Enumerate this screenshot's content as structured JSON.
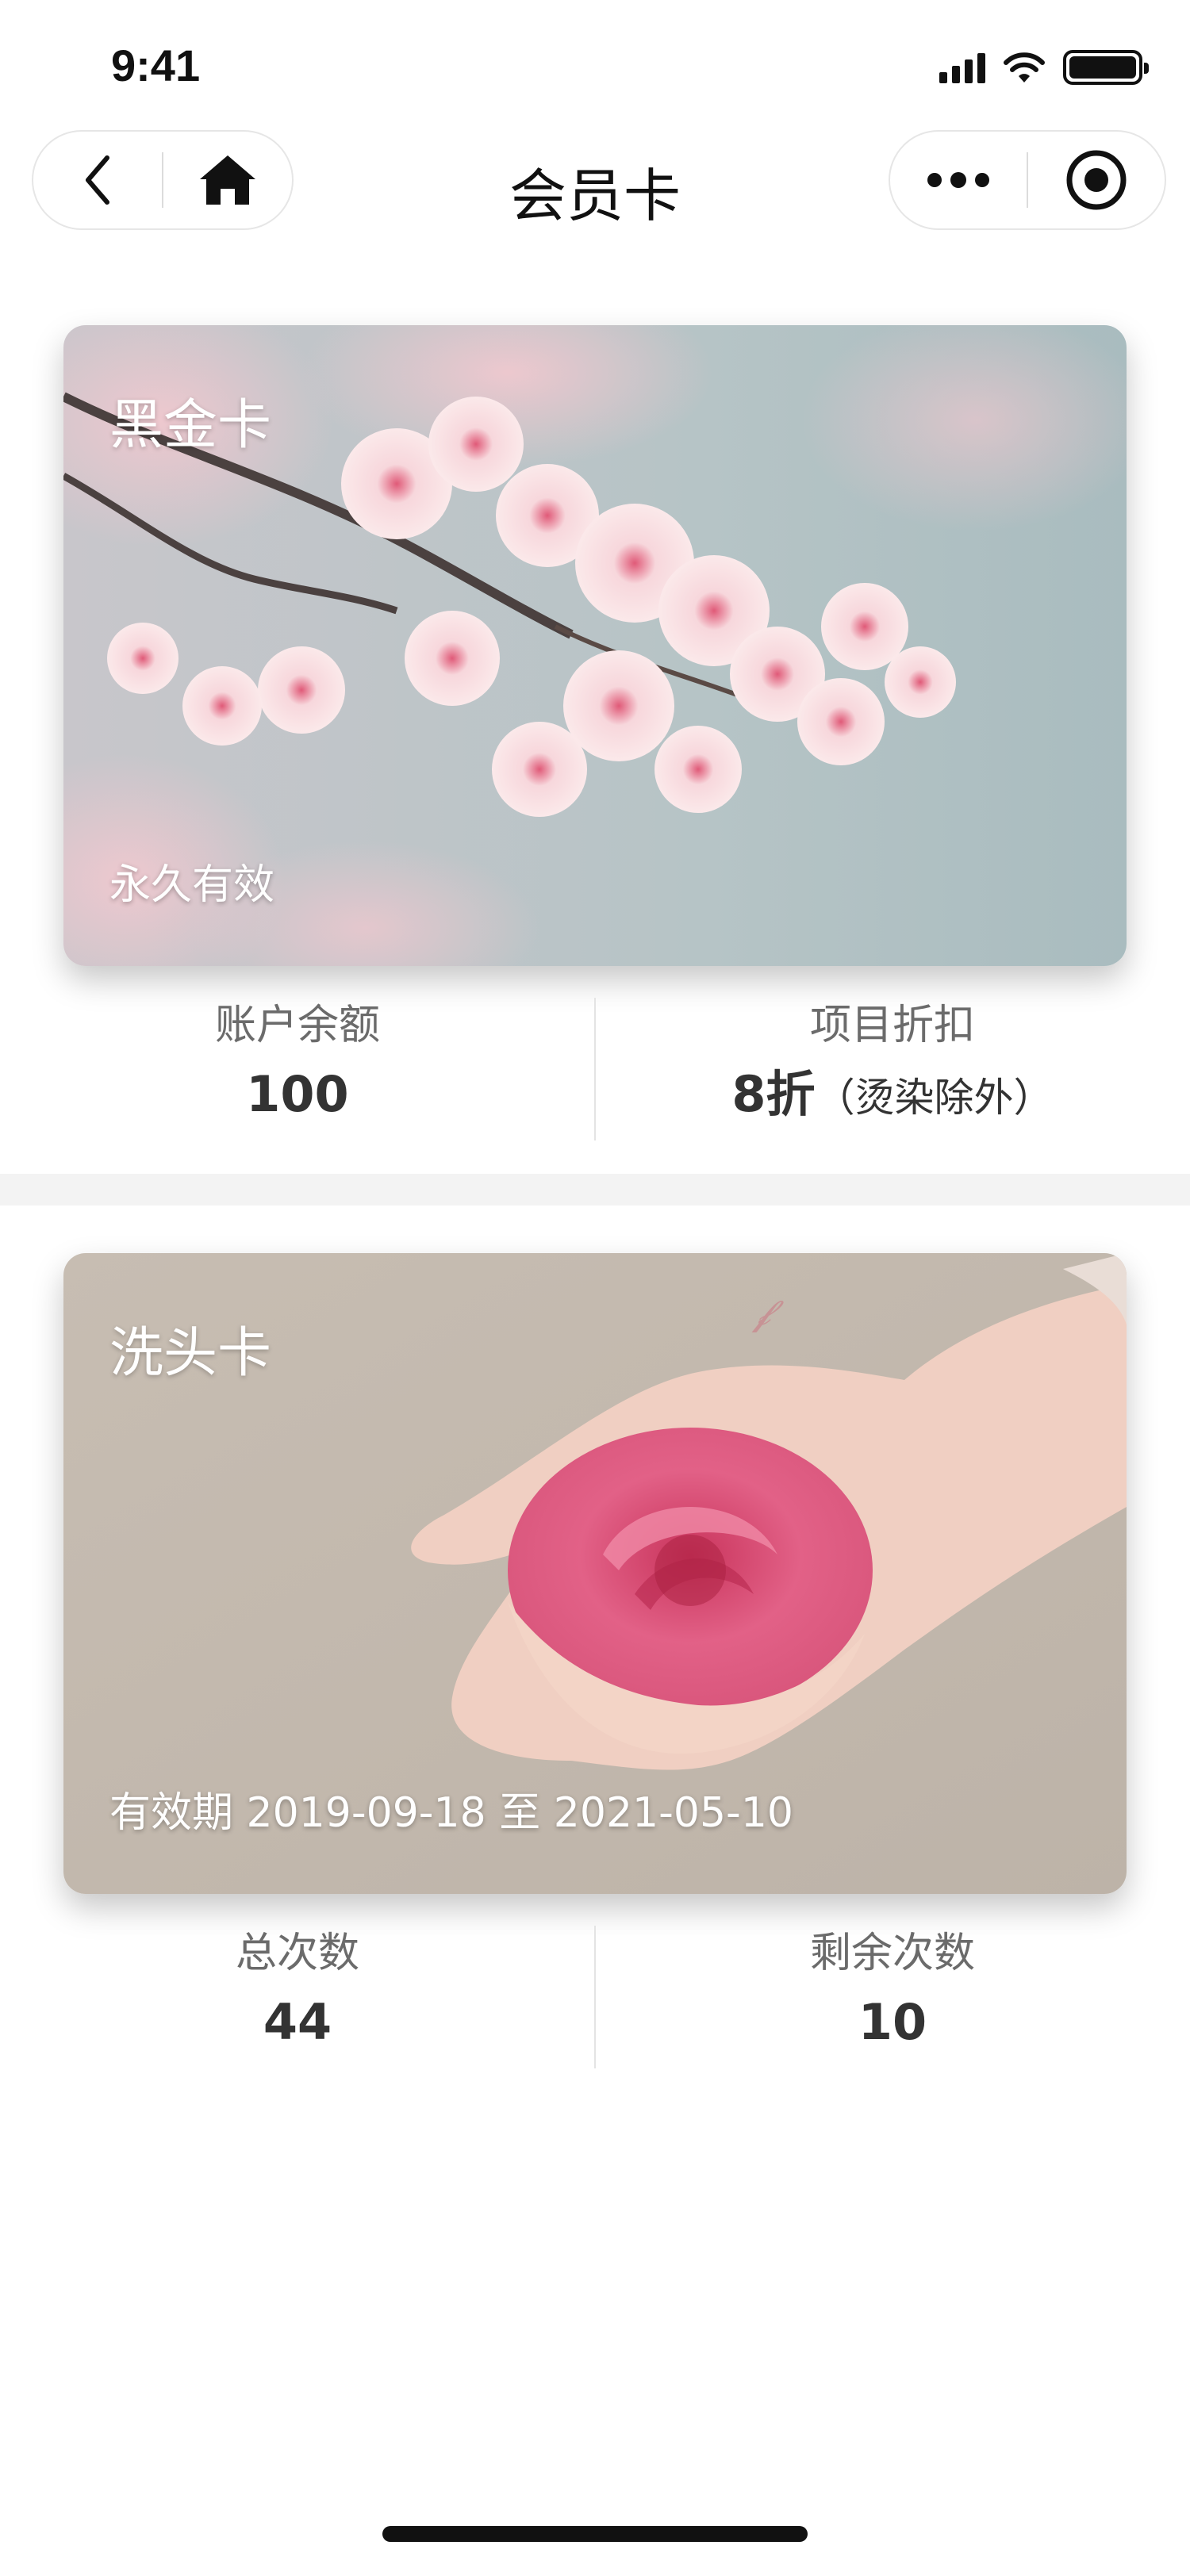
{
  "status_bar": {
    "time": "9:41"
  },
  "nav": {
    "title": "会员卡",
    "back_icon": "chevron-left-icon",
    "home_icon": "home-icon",
    "more_icon": "more-dots-icon",
    "close_icon": "target-circle-icon"
  },
  "cards": [
    {
      "name": "黑金卡",
      "validity": "永久有效",
      "background": "cherry-blossom-photo",
      "stats": [
        {
          "label": "账户余额",
          "value": "100",
          "note": ""
        },
        {
          "label": "项目折扣",
          "value": "8折",
          "note": "（烫染除外）"
        }
      ]
    },
    {
      "name": "洗头卡",
      "validity": "有效期 2019-09-18 至 2021-05-10",
      "background": "rose-in-hands-photo",
      "stats": [
        {
          "label": "总次数",
          "value": "44",
          "note": ""
        },
        {
          "label": "剩余次数",
          "value": "10",
          "note": ""
        }
      ]
    }
  ],
  "colors": {
    "label": "#6b6b6b",
    "value": "#333333",
    "separator": "#f3f3f3",
    "card_text": "#ffffff"
  }
}
